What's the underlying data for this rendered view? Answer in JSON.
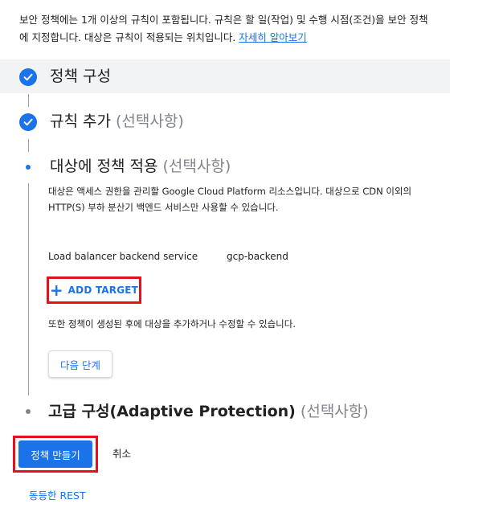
{
  "intro": {
    "text": "보안 정책에는 1개 이상의 규칙이 포함됩니다. 규칙은 할 일(작업) 및 수행 시점(조건)을 보안 정책에 지정합니다. 대상은 규칙이 적용되는 위치입니다. ",
    "link": "자세히 알아보기"
  },
  "steps": [
    {
      "title": "정책 구성",
      "optional": ""
    },
    {
      "title": "규칙 추가",
      "optional": "(선택사항)"
    },
    {
      "title": "대상에 정책 적용",
      "optional": "(선택사항)"
    },
    {
      "title": "고급 구성(Adaptive Protection)",
      "optional": "(선택사항)"
    }
  ],
  "target_section": {
    "description": "대상은 액세스 권한을 관리할 Google Cloud Platform 리소스입니다. 대상으로 CDN 이외의 HTTP(S) 부하 분산기 백엔드 서비스만 사용할 수 있습니다.",
    "target_type": "Load balancer backend service",
    "target_name": "gcp-backend",
    "add_target_label": "ADD TARGET",
    "note": "또한 정책이 생성된 후에 대상을 추가하거나 수정할 수 있습니다.",
    "next_label": "다음 단계"
  },
  "actions": {
    "create_label": "정책 만들기",
    "cancel_label": "취소",
    "rest_label": "동등한 REST"
  },
  "colors": {
    "accent": "#1a73e8",
    "highlight": "#e3111b",
    "band": "#f1f3f4"
  }
}
